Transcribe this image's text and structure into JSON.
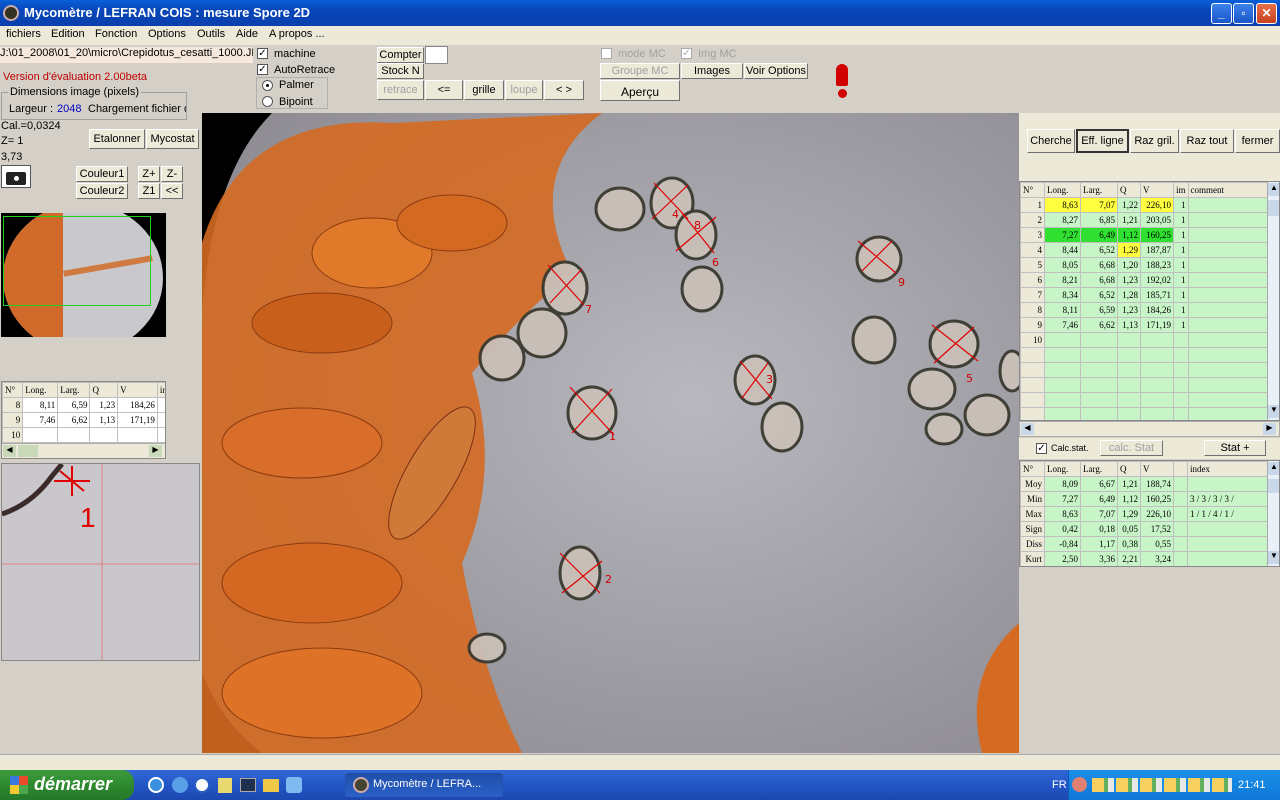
{
  "window": {
    "title": "Mycomètre  /  LEFRAN COIS : mesure Spore 2D"
  },
  "menu": [
    "fichiers",
    "Edition",
    "Fonction",
    "Options",
    "Outils",
    "Aide",
    "A propos ..."
  ],
  "file_path": "J:\\01_2008\\01_20\\micro\\Crepidotus_cesatti_1000.JF",
  "version": "Version d'évaluation 2.00beta",
  "dimensions": {
    "title": "Dimensions image (pixels)",
    "largeur_label": "Largeur :",
    "largeur_value": "2048",
    "chargement": "Chargement fichier d"
  },
  "calib": {
    "cal": "Cal.=0,0324",
    "z": "Z= 1",
    "val": "3,73"
  },
  "left_buttons": {
    "etalonner": "Etalonner",
    "mycostat": "Mycostat",
    "couleur1": "Couleur1",
    "couleur2": "Couleur2",
    "zplus": "Z+",
    "zminus": "Z-",
    "z1": "Z1",
    "back": "<<"
  },
  "options": {
    "machine": "machine",
    "autoretrace": "AutoRetrace",
    "palmer": "Palmer",
    "bipoint": "Bipoint"
  },
  "toolbar": {
    "compter": "Compter",
    "stock": "Stock N",
    "retrace": "retrace",
    "prev": "<=",
    "grille": "grille",
    "loupe": "loupe",
    "nav": "< >",
    "mode_mc": "mode MC",
    "img_mc": "Img MC",
    "groupe_mc": "Groupe MC",
    "images": "Images",
    "voir_options": "Voir Options",
    "apercu": "Aperçu"
  },
  "right_buttons": {
    "cherche": "Cherche",
    "eff_ligne": "Eff.  ligne",
    "raz_gril": "Raz gril.",
    "raz_tout": "Raz tout",
    "fermer": "fermer"
  },
  "measure_table": {
    "headers": [
      "N°",
      "Long.",
      "Larg.",
      "Q",
      "V",
      "im",
      "comment"
    ],
    "rows": [
      [
        "1",
        "8,63",
        "7,07",
        "1,22",
        "226,10",
        "1",
        ""
      ],
      [
        "2",
        "8,27",
        "6,85",
        "1,21",
        "203,05",
        "1",
        ""
      ],
      [
        "3",
        "7,27",
        "6,49",
        "1,12",
        "160,25",
        "1",
        ""
      ],
      [
        "4",
        "8,44",
        "6,52",
        "1,29",
        "187,87",
        "1",
        ""
      ],
      [
        "5",
        "8,05",
        "6,68",
        "1,20",
        "188,23",
        "1",
        ""
      ],
      [
        "6",
        "8,21",
        "6,68",
        "1,23",
        "192,02",
        "1",
        ""
      ],
      [
        "7",
        "8,34",
        "6,52",
        "1,28",
        "185,71",
        "1",
        ""
      ],
      [
        "8",
        "8,11",
        "6,59",
        "1,23",
        "184,26",
        "1",
        ""
      ],
      [
        "9",
        "7,46",
        "6,62",
        "1,13",
        "171,19",
        "1",
        ""
      ],
      [
        "10",
        "",
        "",
        "",
        "",
        "",
        ""
      ]
    ]
  },
  "stats_bar": {
    "calc_stat_chk": "Calc.stat.",
    "calc_stat_btn": "calc. Stat",
    "stat_plus": "Stat +"
  },
  "stats_table": {
    "headers": [
      "N°",
      "Long.",
      "Larg.",
      "Q",
      "V",
      "",
      "index"
    ],
    "rows": [
      [
        "Moy",
        "8,09",
        "6,67",
        "1,21",
        "188,74",
        "",
        ""
      ],
      [
        "Min",
        "7,27",
        "6,49",
        "1,12",
        "160,25",
        "",
        "3 / 3 / 3 / 3 /"
      ],
      [
        "Max",
        "8,63",
        "7,07",
        "1,29",
        "226,10",
        "",
        "1 / 1 / 4 / 1 /"
      ],
      [
        "Sign",
        "0,42",
        "0,18",
        "0,05",
        "17,52",
        "",
        ""
      ],
      [
        "Diss",
        "-0,84",
        "1,17",
        "0,38",
        "0,55",
        "",
        ""
      ],
      [
        "Kurt",
        "2,50",
        "3,36",
        "2,21",
        "3,24",
        "",
        ""
      ]
    ]
  },
  "small_table": {
    "headers": [
      "N°",
      "Long.",
      "Larg.",
      "Q",
      "V",
      "ir"
    ],
    "rows": [
      [
        "8",
        "8,11",
        "6,59",
        "1,23",
        "184,26",
        ""
      ],
      [
        "9",
        "7,46",
        "6,62",
        "1,13",
        "171,19",
        ""
      ],
      [
        "10",
        "",
        "",
        "",
        "",
        ""
      ]
    ]
  },
  "zoom_label": "1",
  "spore_labels": [
    "1",
    "2",
    "3",
    "4",
    "5",
    "6",
    "7",
    "8",
    "9"
  ],
  "taskbar": {
    "start": "démarrer",
    "task": "Mycomètre  /  LEFRA...",
    "lang": "FR",
    "clock": "21:41"
  }
}
